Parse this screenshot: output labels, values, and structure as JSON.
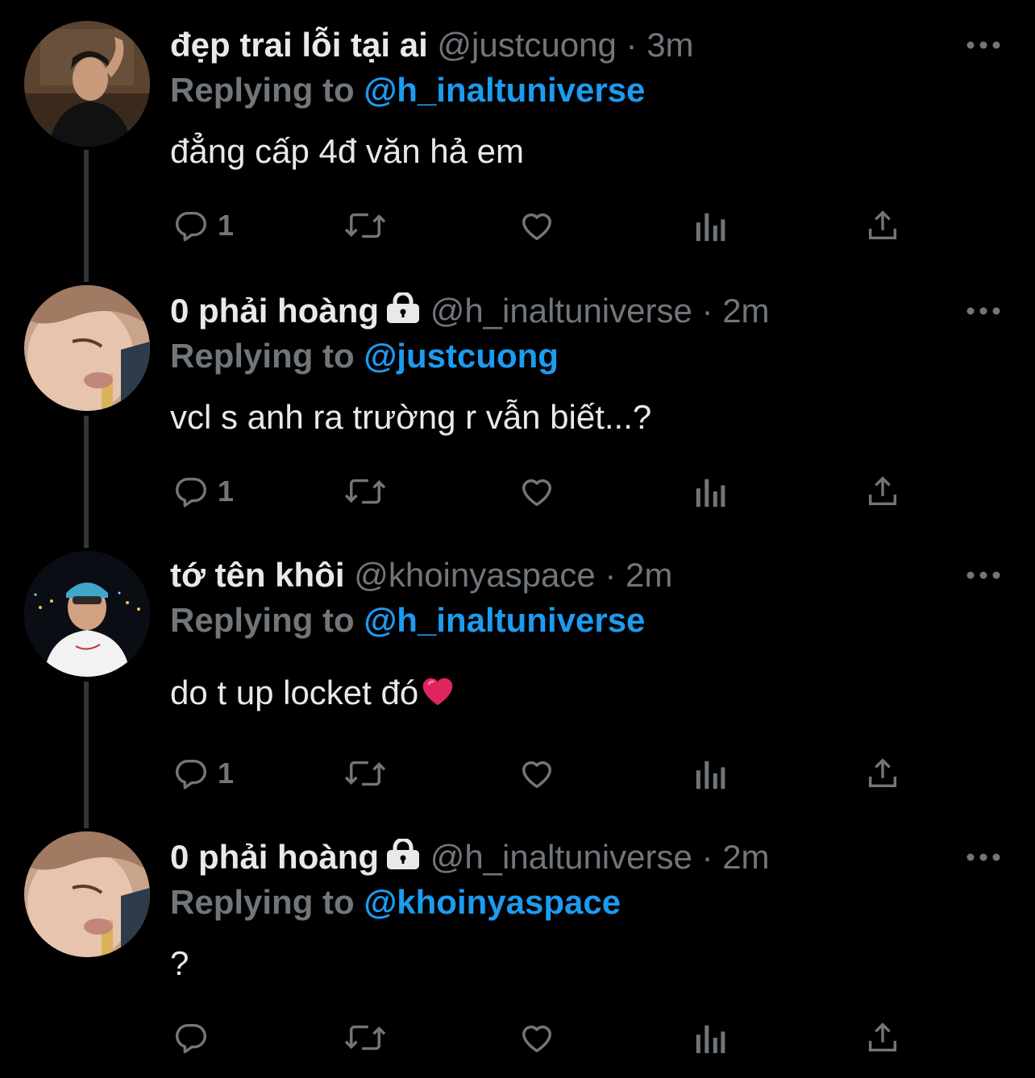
{
  "tweets": [
    {
      "name": "đẹp trai lỗi tại ai",
      "handle": "@justcuong",
      "separator": "·",
      "time": "3m",
      "replying_label": "Replying to",
      "mention": "@h_inaltuniverse",
      "text": "đẳng cấp 4đ văn hả em",
      "reply_count": "1",
      "locked": false
    },
    {
      "name": "0 phải hoàng",
      "handle": "@h_inaltuniverse",
      "separator": "·",
      "time": "2m",
      "replying_label": "Replying to",
      "mention": "@justcuong",
      "text": "vcl s anh ra trường r vẫn biết...?",
      "reply_count": "1",
      "locked": true
    },
    {
      "name": "tớ tên khôi",
      "handle": "@khoinyaspace",
      "separator": "·",
      "time": "2m",
      "replying_label": "Replying to",
      "mention": "@h_inaltuniverse",
      "text": "do t up locket đó",
      "reply_count": "1",
      "locked": false,
      "emoji": "heart-emoji"
    },
    {
      "name": "0 phải hoàng",
      "handle": "@h_inaltuniverse",
      "separator": "·",
      "time": "2m",
      "replying_label": "Replying to",
      "mention": "@khoinyaspace",
      "text": "?",
      "reply_count": "",
      "locked": true
    }
  ],
  "icons": {
    "reply": "reply-icon",
    "retweet": "retweet-icon",
    "like": "like-icon",
    "views": "views-icon",
    "share": "share-icon",
    "more": "more-icon",
    "lock": "lock-icon"
  },
  "colors": {
    "background": "#000000",
    "text": "#e7e9ea",
    "muted": "#71767b",
    "accent": "#1d9bf0",
    "thread_line": "#333639"
  }
}
